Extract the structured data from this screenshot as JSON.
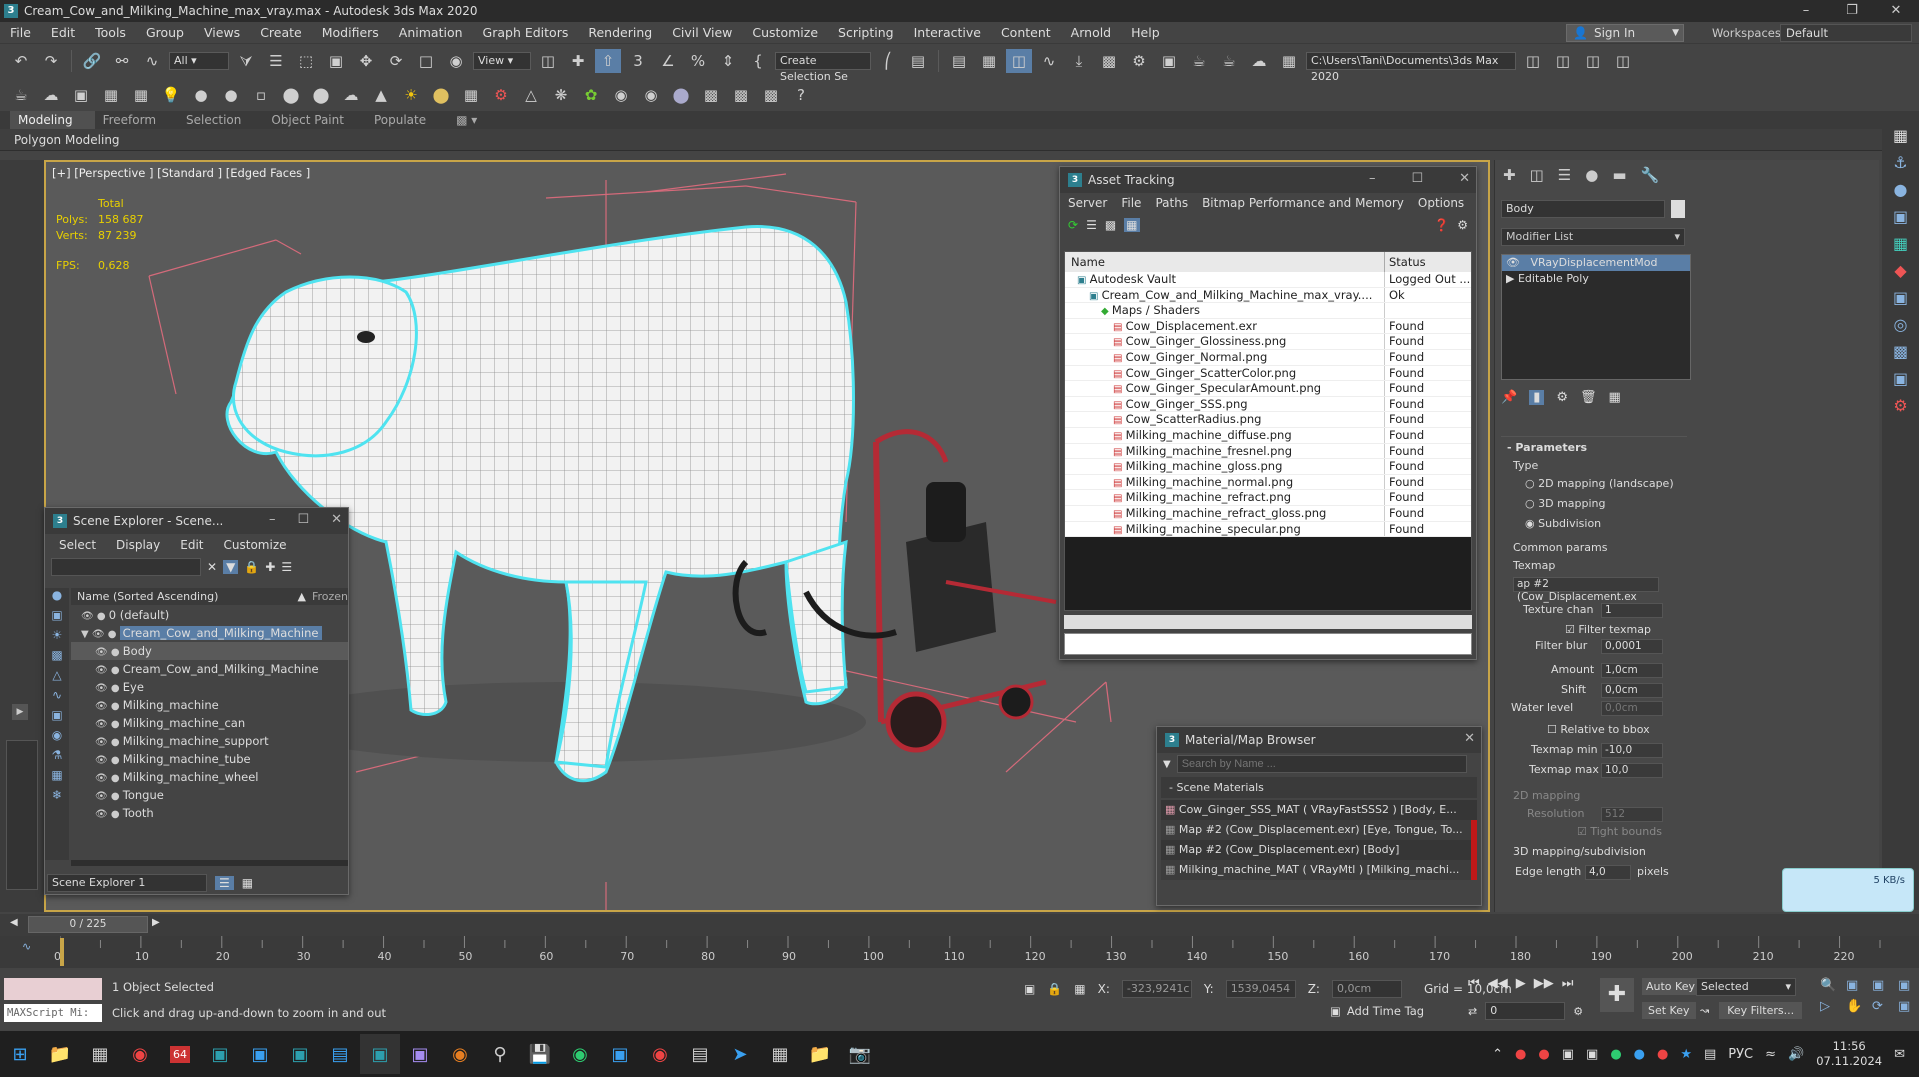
{
  "window": {
    "title": "Cream_Cow_and_Milking_Machine_max_vray.max - Autodesk 3ds Max 2020",
    "app_icon": "3"
  },
  "menu": [
    "File",
    "Edit",
    "Tools",
    "Group",
    "Views",
    "Create",
    "Modifiers",
    "Animation",
    "Graph Editors",
    "Rendering",
    "Civil View",
    "Customize",
    "Scripting",
    "Interactive",
    "Content",
    "Arnold",
    "Help"
  ],
  "account": {
    "sign_in": "Sign In",
    "workspaces_label": "Workspaces:",
    "workspace": "Default"
  },
  "toolbar": {
    "filter_all": "All",
    "ref_coord": "View",
    "selection_set": "Create Selection Se",
    "project_path": "C:\\Users\\Tani\\Documents\\3ds Max 2020"
  },
  "ribbon": {
    "tabs": [
      "Modeling",
      "Freeform",
      "Selection",
      "Object Paint",
      "Populate"
    ],
    "active_tab": "Modeling",
    "panel": "Polygon Modeling"
  },
  "viewport": {
    "label": "[+] [Perspective ] [Standard ] [Edged Faces ]",
    "stats_total": "Total",
    "polys_label": "Polys:",
    "polys": "158 687",
    "verts_label": "Verts:",
    "verts": "87 239",
    "fps_label": "FPS:",
    "fps": "0,628"
  },
  "scene_explorer": {
    "title": "Scene Explorer - Scene...",
    "menu": [
      "Select",
      "Display",
      "Edit",
      "Customize"
    ],
    "column": "Name (Sorted Ascending)",
    "column2": "Frozen",
    "items": [
      {
        "name": "0 (default)",
        "level": 1
      },
      {
        "name": "Cream_Cow_and_Milking_Machine",
        "level": 1,
        "highlight": true
      },
      {
        "name": "Body",
        "level": 2,
        "selected": true
      },
      {
        "name": "Cream_Cow_and_Milking_Machine",
        "level": 2
      },
      {
        "name": "Eye",
        "level": 2
      },
      {
        "name": "Milking_machine",
        "level": 2
      },
      {
        "name": "Milking_machine_can",
        "level": 2
      },
      {
        "name": "Milking_machine_support",
        "level": 2
      },
      {
        "name": "Milking_machine_tube",
        "level": 2
      },
      {
        "name": "Milking_machine_wheel",
        "level": 2
      },
      {
        "name": "Tongue",
        "level": 2
      },
      {
        "name": "Tooth",
        "level": 2
      }
    ],
    "footer": "Scene Explorer 1"
  },
  "asset_tracking": {
    "title": "Asset Tracking",
    "menu": [
      "Server",
      "File",
      "Paths",
      "Bitmap Performance and Memory",
      "Options"
    ],
    "col_name": "Name",
    "col_status": "Status",
    "rows": [
      {
        "name": "Autodesk Vault",
        "status": "Logged Out ...",
        "indent": 1
      },
      {
        "name": "Cream_Cow_and_Milking_Machine_max_vray....",
        "status": "Ok",
        "indent": 2
      },
      {
        "name": "Maps / Shaders",
        "status": "",
        "indent": 3
      },
      {
        "name": "Cow_Displacement.exr",
        "status": "Found",
        "indent": 4
      },
      {
        "name": "Cow_Ginger_Glossiness.png",
        "status": "Found",
        "indent": 4
      },
      {
        "name": "Cow_Ginger_Normal.png",
        "status": "Found",
        "indent": 4
      },
      {
        "name": "Cow_Ginger_ScatterColor.png",
        "status": "Found",
        "indent": 4
      },
      {
        "name": "Cow_Ginger_SpecularAmount.png",
        "status": "Found",
        "indent": 4
      },
      {
        "name": "Cow_Ginger_SSS.png",
        "status": "Found",
        "indent": 4
      },
      {
        "name": "Cow_ScatterRadius.png",
        "status": "Found",
        "indent": 4
      },
      {
        "name": "Milking_machine_diffuse.png",
        "status": "Found",
        "indent": 4
      },
      {
        "name": "Milking_machine_fresnel.png",
        "status": "Found",
        "indent": 4
      },
      {
        "name": "Milking_machine_gloss.png",
        "status": "Found",
        "indent": 4
      },
      {
        "name": "Milking_machine_normal.png",
        "status": "Found",
        "indent": 4
      },
      {
        "name": "Milking_machine_refract.png",
        "status": "Found",
        "indent": 4
      },
      {
        "name": "Milking_machine_refract_gloss.png",
        "status": "Found",
        "indent": 4
      },
      {
        "name": "Milking_machine_specular.png",
        "status": "Found",
        "indent": 4
      }
    ]
  },
  "material_browser": {
    "title": "Material/Map Browser",
    "search_placeholder": "Search by Name ...",
    "group": "- Scene Materials",
    "items": [
      "Cow_Ginger_SSS_MAT ( VRayFastSSS2 ) [Body, E...",
      "Map #2 (Cow_Displacement.exr) [Eye, Tongue, To...",
      "Map #2 (Cow_Displacement.exr) [Body]",
      "Milking_machine_MAT ( VRayMtl ) [Milking_machi..."
    ]
  },
  "command_panel": {
    "object_name": "Body",
    "modifier_list": "Modifier List",
    "stack": [
      "VRayDisplacementMod",
      "Editable Poly"
    ],
    "parameters": "Parameters",
    "type_label": "Type",
    "type_options": [
      "2D mapping (landscape)",
      "3D mapping",
      "Subdivision"
    ],
    "type_selected": 2,
    "common_params": "Common params",
    "texmap_label": "Texmap",
    "texmap_value": "ap #2 (Cow_Displacement.ex",
    "texture_chan_label": "Texture chan",
    "texture_chan": "1",
    "filter_texmap": "Filter texmap",
    "filter_blur_label": "Filter blur",
    "filter_blur": "0,0001",
    "amount_label": "Amount",
    "amount": "1,0cm",
    "shift_label": "Shift",
    "shift": "0,0cm",
    "water_label": "Water level",
    "water": "0,0cm",
    "relative_bbox": "Relative to bbox",
    "texmap_min_label": "Texmap min",
    "texmap_min": "-10,0",
    "texmap_max_label": "Texmap max",
    "texmap_max": "10,0",
    "mapping2d": "2D mapping",
    "resolution_label": "Resolution",
    "resolution": "512",
    "tight_bounds": "Tight bounds",
    "mapping3d": "3D mapping/subdivision",
    "edge_length_label": "Edge length",
    "edge_length": "4,0",
    "pixels": "pixels"
  },
  "net_widget": {
    "speed": "5 KB/s"
  },
  "timeline": {
    "frame": "0 / 225",
    "ticks": [
      "0",
      "10",
      "20",
      "30",
      "40",
      "50",
      "60",
      "70",
      "80",
      "90",
      "100",
      "110",
      "120",
      "130",
      "140",
      "150",
      "160",
      "170",
      "180",
      "190",
      "200",
      "210",
      "220"
    ]
  },
  "status": {
    "maxscript": "MAXScript Mi:",
    "selected": "1 Object Selected",
    "hint": "Click and drag up-and-down to zoom in and out",
    "x_label": "X:",
    "x": "-323,9241c",
    "y_label": "Y:",
    "y": "1539,0454",
    "z_label": "Z:",
    "z": "0,0cm",
    "grid": "Grid = 10,0cm",
    "add_time_tag": "Add Time Tag",
    "auto_key": "Auto Key",
    "set_key": "Set Key",
    "selected_dropdown": "Selected",
    "key_filters": "Key Filters...",
    "frame_field": "0"
  },
  "taskbar": {
    "lang": "РУС",
    "time": "11:56",
    "date": "07.11.2024",
    "badge": "64"
  },
  "colors": {
    "viewport_border": "#c8a548",
    "selection_outline": "#4fe3f0",
    "stats": "#e8d000",
    "accent_blue": "#5a7ea6"
  }
}
